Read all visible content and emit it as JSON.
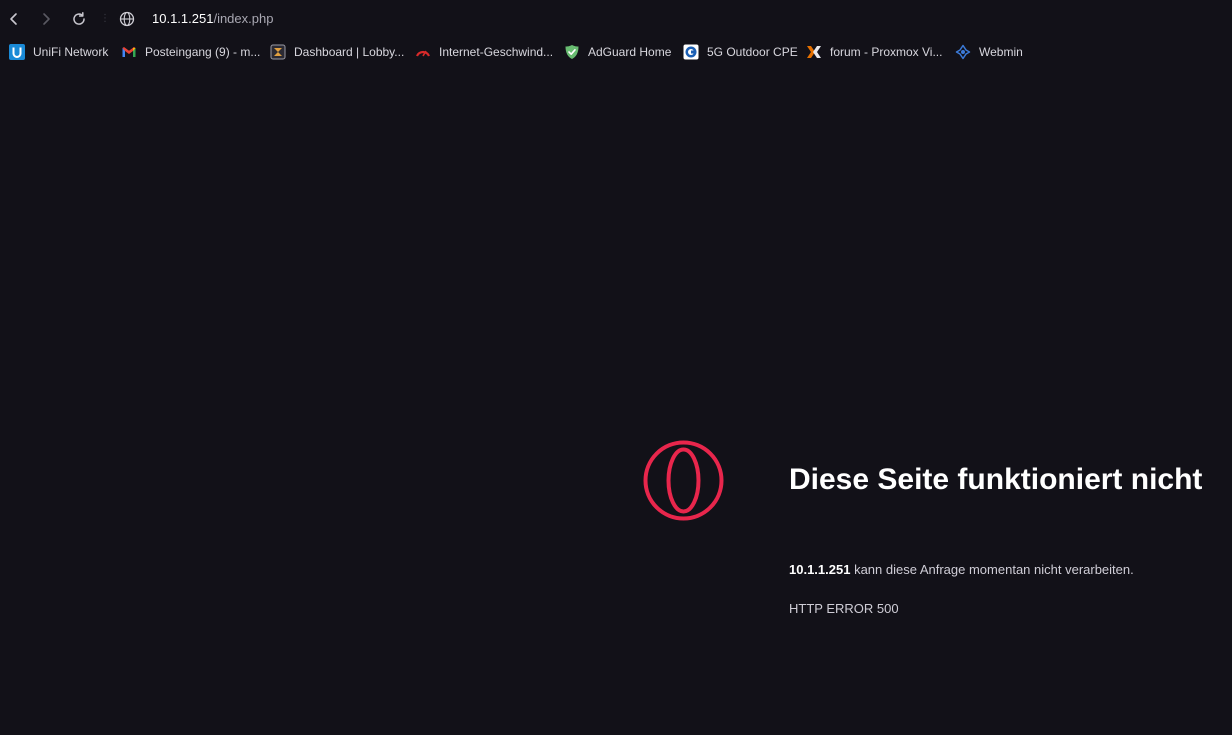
{
  "toolbar": {
    "back_icon": "chevron-left-icon",
    "forward_icon": "chevron-right-icon",
    "reload_icon": "reload-icon",
    "site_info_icon": "globe-icon",
    "url_host": "10.1.1.251",
    "url_path": "/index.php"
  },
  "bookmarks": [
    {
      "label": "UniFi Network",
      "icon": "unifi-icon"
    },
    {
      "label": "Posteingang (9) - m...",
      "icon": "gmail-icon"
    },
    {
      "label": "Dashboard | Lobby...",
      "icon": "lobby-icon"
    },
    {
      "label": "Internet-Geschwind...",
      "icon": "speedometer-icon"
    },
    {
      "label": "AdGuard Home",
      "icon": "adguard-shield-icon"
    },
    {
      "label": "5G Outdoor CPE",
      "icon": "cpe-icon"
    },
    {
      "label": "forum - Proxmox Vi...",
      "icon": "proxmox-icon"
    },
    {
      "label": "Webmin",
      "icon": "webmin-icon"
    }
  ],
  "error": {
    "logo_icon": "opera-logo-icon",
    "title": "Diese Seite funktioniert nicht",
    "host": "10.1.1.251",
    "message": " kann diese Anfrage momentan nicht verarbeiten.",
    "code": "HTTP ERROR 500"
  },
  "colors": {
    "background": "#121118",
    "accent": "#e8264c",
    "text": "#ffffff",
    "muted_text": "#cfcdd6"
  }
}
